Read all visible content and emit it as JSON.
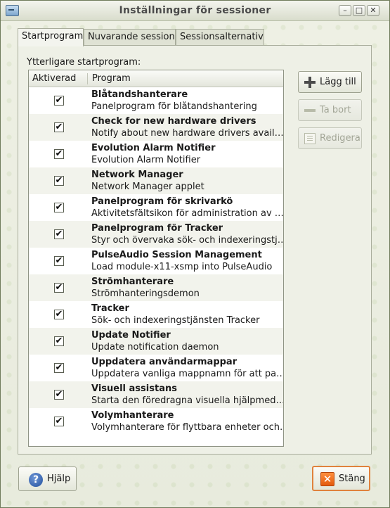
{
  "window": {
    "title": "Inställningar för sessioner",
    "controls": [
      "minimize-icon",
      "maximize-icon",
      "close-icon"
    ]
  },
  "tabs": [
    {
      "label": "Startprogram",
      "active": true
    },
    {
      "label": "Nuvarande session",
      "active": false
    },
    {
      "label": "Sessionsalternativ",
      "active": false
    }
  ],
  "startup": {
    "section_label": "Ytterligare startprogram:",
    "columns": {
      "enabled": "Aktiverad",
      "program": "Program"
    },
    "rows": [
      {
        "enabled": true,
        "name": "Blåtandshanterare",
        "desc": "Panelprogram för blåtandshantering"
      },
      {
        "enabled": true,
        "name": "Check for new hardware drivers",
        "desc": "Notify about new hardware drivers availabl..."
      },
      {
        "enabled": true,
        "name": "Evolution Alarm Notifier",
        "desc": "Evolution Alarm Notifier"
      },
      {
        "enabled": true,
        "name": "Network Manager",
        "desc": "Network Manager applet"
      },
      {
        "enabled": true,
        "name": "Panelprogram för skrivarkö",
        "desc": "Aktivitetsfältsikon för administration av uts..."
      },
      {
        "enabled": true,
        "name": "Panelprogram för Tracker",
        "desc": "Styr och övervaka sök- och indexeringstjän..."
      },
      {
        "enabled": true,
        "name": "PulseAudio Session Management",
        "desc": "Load module-x11-xsmp into PulseAudio"
      },
      {
        "enabled": true,
        "name": "Strömhanterare",
        "desc": "Strömhanteringsdemon"
      },
      {
        "enabled": true,
        "name": "Tracker",
        "desc": "Sök- och indexeringstjänsten Tracker"
      },
      {
        "enabled": true,
        "name": "Update Notifier",
        "desc": "Update notification daemon"
      },
      {
        "enabled": true,
        "name": "Uppdatera användarmappar",
        "desc": "Uppdatera vanliga mappnamn för att pass..."
      },
      {
        "enabled": true,
        "name": "Visuell assistans",
        "desc": "Starta den föredragna visuella hjälpmedels..."
      },
      {
        "enabled": true,
        "name": "Volymhanterare",
        "desc": "Volymhanterare för flyttbara enheter och m..."
      }
    ],
    "check_glyph": "✔",
    "buttons": {
      "add": "Lägg till",
      "remove": "Ta bort",
      "edit": "Redigera"
    }
  },
  "footer": {
    "help": "Hjälp",
    "close": "Stäng",
    "help_glyph": "?",
    "close_glyph": "✕"
  }
}
